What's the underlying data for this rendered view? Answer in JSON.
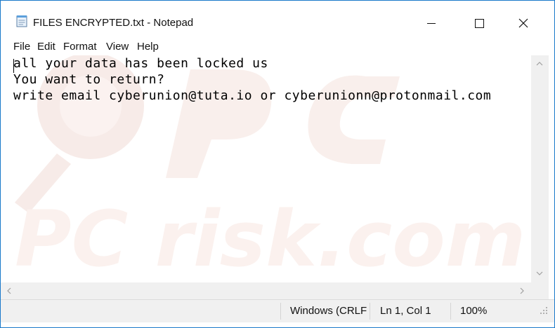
{
  "window": {
    "title": "FILES ENCRYPTED.txt - Notepad"
  },
  "menu": [
    "File",
    "Edit",
    "Format",
    "View",
    "Help"
  ],
  "editor": {
    "lines": [
      "all your data has been locked us",
      "You want to return?",
      "write email cyberunion@tuta.io or cyberunionn@protonmail.com"
    ]
  },
  "status": {
    "encoding": "Windows (CRLF",
    "position": "Ln 1, Col 1",
    "zoom": "100%"
  },
  "watermark": {
    "text": "PC risk.com"
  },
  "colors": {
    "border": "#1979ca",
    "chrome": "#f0f0f0",
    "watermark": "#f7e9e6"
  }
}
